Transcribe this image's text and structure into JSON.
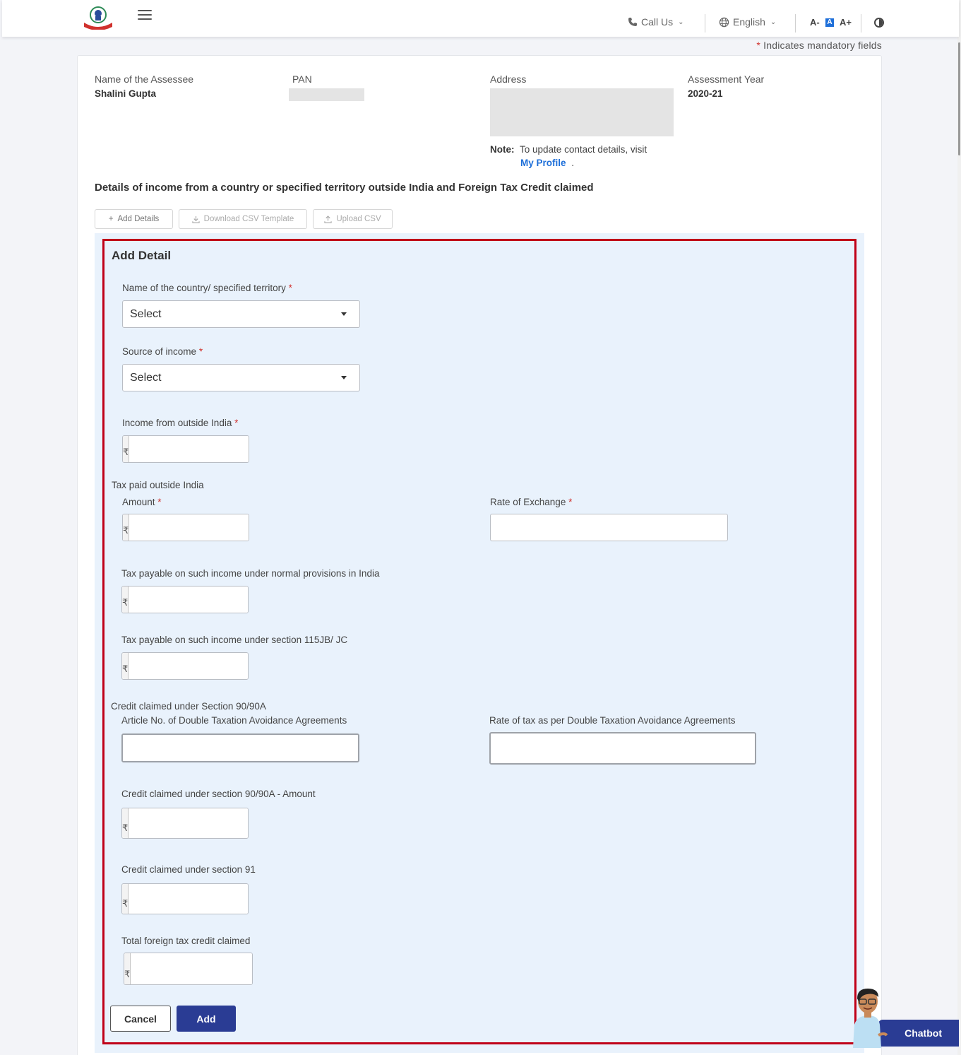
{
  "header": {
    "menu_icon": "hamburger-icon",
    "call_us": "Call Us",
    "language": "English",
    "font_decrease": "A-",
    "font_default": "A",
    "font_increase": "A+",
    "contrast_icon": "contrast-icon"
  },
  "mandatory_note": {
    "asterisk": "*",
    "text": "Indicates mandatory fields"
  },
  "assessee": {
    "name_label": "Name of the Assessee",
    "name_value": "Shalini Gupta",
    "pan_label": "PAN",
    "address_label": "Address",
    "ay_label": "Assessment Year",
    "ay_value": "2020-21",
    "note_label": "Note:",
    "note_text": "To update contact details, visit",
    "profile_link": "My Profile",
    "profile_suffix": "."
  },
  "section": {
    "title": "Details of income from a country or specified territory outside India and Foreign Tax Credit claimed",
    "add_details": "Add Details",
    "download_template": "Download CSV Template",
    "upload_csv": "Upload CSV"
  },
  "form": {
    "title": "Add Detail",
    "country_label": "Name of the country/ specified territory",
    "country_value": "Select",
    "source_label": "Source of income",
    "source_value": "Select",
    "income_label": "Income from outside India",
    "tax_paid_group": "Tax paid outside India",
    "amount_label": "Amount",
    "exchange_label": "Rate of Exchange",
    "tax_normal_label": "Tax payable on such income under normal provisions in India",
    "tax_115_label": "Tax payable on such income under section 115JB/ JC",
    "credit_group": "Credit claimed under Section 90/90A",
    "article_label": "Article No. of Double Taxation Avoidance Agreements",
    "rate_dtaa_label": "Rate of tax as per Double Taxation Avoidance Agreements",
    "credit_9090a_label": "Credit claimed under section 90/90A - Amount",
    "credit_91_label": "Credit claimed under section 91",
    "total_credit_label": "Total foreign tax credit claimed",
    "currency_symbol": "₹",
    "required_mark": "*",
    "cancel": "Cancel",
    "add": "Add"
  },
  "chatbot": {
    "label": "Chatbot"
  },
  "colors": {
    "primary": "#2a3c94",
    "link": "#1e6fd9",
    "required": "#d0312d",
    "highlight": "#c00018",
    "panel": "#e9f2fc"
  }
}
